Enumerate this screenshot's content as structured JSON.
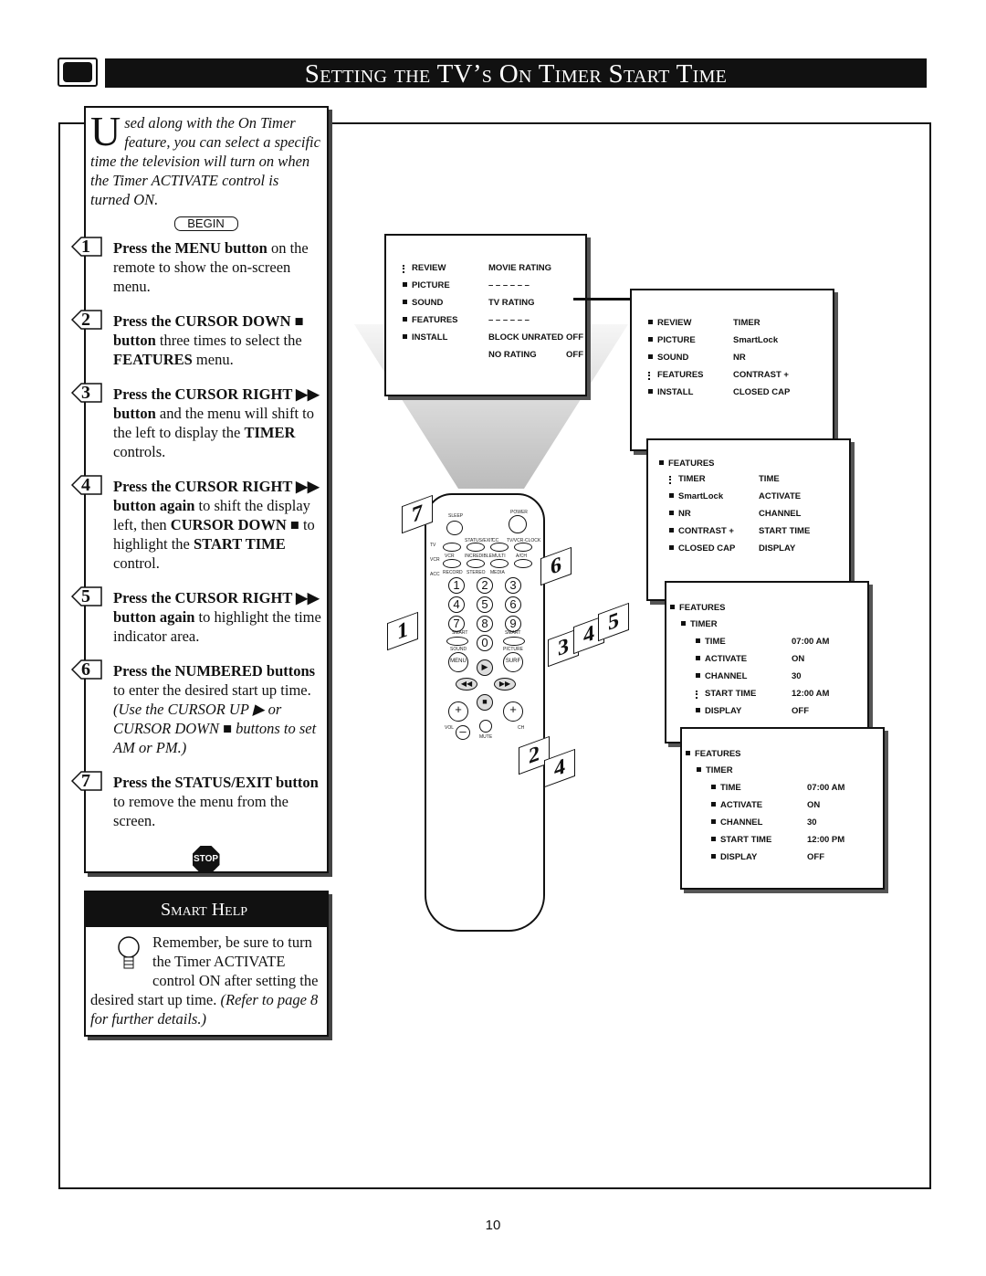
{
  "header": {
    "title": "Setting the TV’s On Timer Start Time",
    "icon": "tv-icon"
  },
  "intro": {
    "dropcap": "U",
    "text": "sed along with the On Timer feature, you can select a specific time the television will turn on when the Timer ACTIVATE control is turned ON.",
    "begin": "BEGIN"
  },
  "steps": [
    {
      "n": "1",
      "bold": "Press the MENU button",
      "rest": " on the remote to show the on-screen menu."
    },
    {
      "n": "2",
      "bold": "Press the CURSOR DOWN ■ button",
      "rest": " three times to select the ",
      "bold2": "FEATURES",
      "rest2": " menu."
    },
    {
      "n": "3",
      "bold": "Press the CURSOR RIGHT ▶▶ button",
      "rest": " and the menu will shift to the left to display the ",
      "bold2": "TIMER",
      "rest2": " controls."
    },
    {
      "n": "4",
      "bold": "Press the CURSOR RIGHT ▶▶ button again",
      "rest": " to shift the display left, then ",
      "bold2": "CURSOR DOWN ■",
      "rest2": " to highlight the ",
      "bold3": "START TIME",
      "rest3": " control."
    },
    {
      "n": "5",
      "bold": "Press the CURSOR RIGHT ▶▶ button again",
      "rest": " to highlight the time indicator area."
    },
    {
      "n": "6",
      "bold": "Press the NUMBERED buttons",
      "rest": " to enter the desired start up time.",
      "italic": "(Use the CURSOR UP ▶ or CURSOR DOWN ■ buttons to set AM or PM.)"
    },
    {
      "n": "7",
      "bold": "Press the STATUS/EXIT button",
      "rest": " to remove the menu from the screen."
    }
  ],
  "stop_sign": "STOP",
  "smart_help": {
    "title": "Smart Help",
    "text": "Remember, be sure to turn the Timer ACTIVATE control ON after setting the desired start up time.",
    "italic": "(Refer to page 8 for further details.)"
  },
  "menus": {
    "main": {
      "left": [
        "REVIEW",
        "PICTURE",
        "SOUND",
        "FEATURES",
        "INSTALL"
      ],
      "right": [
        "MOVIE RATING",
        "– – – – – –",
        "TV RATING",
        "– – – – – –",
        "BLOCK UNRATED",
        "NO RATING"
      ],
      "values": [
        "OFF",
        "OFF"
      ]
    },
    "features_menu": {
      "left": [
        "REVIEW",
        "PICTURE",
        "SOUND",
        "FEATURES",
        "INSTALL"
      ],
      "right": [
        "TIMER",
        "SmartLock",
        "NR",
        "CONTRAST +",
        "CLOSED CAP"
      ]
    },
    "timer_menu": {
      "header": "FEATURES",
      "left": [
        "TIMER",
        "SmartLock",
        "NR",
        "CONTRAST +",
        "CLOSED CAP"
      ],
      "right": [
        "TIME",
        "ACTIVATE",
        "CHANNEL",
        "START TIME",
        "DISPLAY"
      ]
    },
    "timer_detail_1": {
      "path": [
        "FEATURES",
        "TIMER"
      ],
      "rows": [
        [
          "TIME",
          "07:00 AM"
        ],
        [
          "ACTIVATE",
          "ON"
        ],
        [
          "CHANNEL",
          "30"
        ],
        [
          "START TIME",
          "12:00 AM"
        ],
        [
          "DISPLAY",
          "OFF"
        ]
      ]
    },
    "timer_detail_2": {
      "path": [
        "FEATURES",
        "TIMER"
      ],
      "rows": [
        [
          "TIME",
          "07:00 AM"
        ],
        [
          "ACTIVATE",
          "ON"
        ],
        [
          "CHANNEL",
          "30"
        ],
        [
          "START TIME",
          "12:00 PM"
        ],
        [
          "DISPLAY",
          "OFF"
        ]
      ]
    }
  },
  "remote": {
    "labels": {
      "sleep": "SLEEP",
      "power": "POWER",
      "status": "STATUS/EXIT",
      "cc": "CC",
      "clock": "TV/VCR·CLOCK",
      "tv": "TV",
      "vcr": "VCR",
      "acc": "ACC",
      "vcr2": "VCR",
      "incredible": "INCREDIBLE",
      "multi": "MULTI",
      "ach": "A/CH",
      "record": "RECORD",
      "stereo": "STEREO",
      "media": "MEDIA",
      "smart1": "SMART",
      "smart2": "SMART",
      "sound": "SOUND",
      "picture": "PICTURE",
      "menu": "MENU",
      "surf": "SURF",
      "vol": "VOL",
      "ch": "CH",
      "mute": "MUTE"
    },
    "digits": [
      "1",
      "2",
      "3",
      "4",
      "5",
      "6",
      "7",
      "8",
      "9",
      "0"
    ],
    "step_tags": [
      "7",
      "6",
      "1",
      "3",
      "4",
      "5",
      "2",
      "4"
    ]
  },
  "page_number": "10"
}
